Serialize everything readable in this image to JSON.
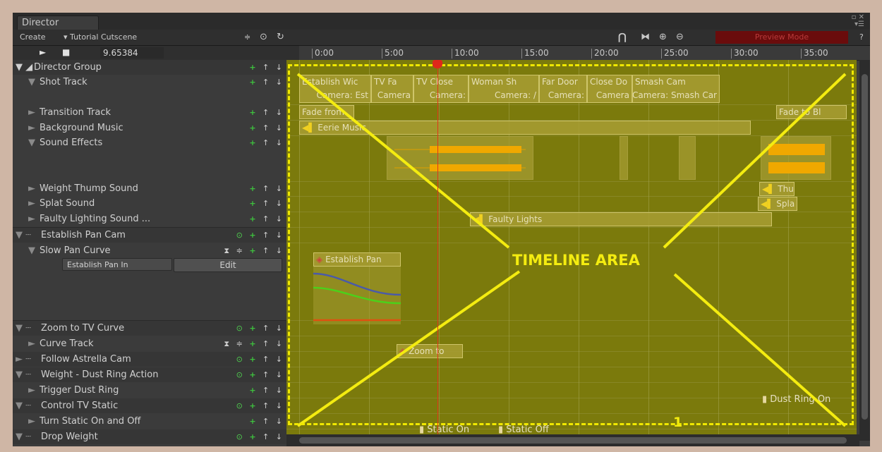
{
  "window": {
    "title": "Director",
    "icons": [
      "▫ ✕",
      "▾☰"
    ]
  },
  "toolbar": {
    "create": "Create",
    "cutscene": "▾ Tutorial Cutscene",
    "stepper": "≑",
    "settings_icon": "⊙",
    "refresh_icon": "↻",
    "magnet_icon": "⋂",
    "fit_icon": "⧓",
    "zoom_in_icon": "⊕",
    "zoom_out_icon": "⊖",
    "preview_mode": "Preview Mode",
    "help": "?"
  },
  "playback": {
    "play_icon": "►",
    "stop_icon": "■",
    "time": "9.65384"
  },
  "ruler": {
    "ticks": [
      "0:00",
      "5:00",
      "10:00",
      "15:00",
      "20:00",
      "25:00",
      "30:00",
      "35:00"
    ]
  },
  "tracks": {
    "director_group": "Director Group",
    "shot_track": "Shot Track",
    "transition_track": "Transition Track",
    "background_music": "Background Music",
    "sound_effects": "Sound Effects",
    "weight_thump": "Weight Thump Sound",
    "splat_sound": "Splat Sound",
    "faulty_lighting": "Faulty Lighting Sound ...",
    "establish_pan_cam": "Establish Pan Cam",
    "slow_pan_curve": "Slow Pan Curve",
    "establish_pan_in": "Establish Pan In",
    "edit": "Edit",
    "zoom_tv_curve": "Zoom to TV Curve",
    "curve_track": "Curve Track",
    "follow_astrella": "Follow Astrella Cam",
    "weight_dust": "Weight - Dust Ring Action",
    "trigger_dust": "Trigger Dust Ring",
    "control_tv_static": "Control TV Static",
    "turn_static": "Turn Static On and Off",
    "drop_weight": "Drop Weight"
  },
  "clips": {
    "shots": [
      {
        "a": "Establish Wic",
        "b": "Camera: Est"
      },
      {
        "a": "TV Fa",
        "b": "Camera"
      },
      {
        "a": "TV Close",
        "b": "Camera:"
      },
      {
        "a": "Woman Sh",
        "b": "Camera: /"
      },
      {
        "a": "Far Door",
        "b": "Camera:"
      },
      {
        "a": "Close Do",
        "b": "Camera"
      },
      {
        "a": "Smash Cam",
        "b": "Camera: Smash Car"
      }
    ],
    "fade_from": "Fade from",
    "fade_to": "Fade to Bl",
    "eerie_music": "Eerie Music",
    "thump": "Thu",
    "splat": "Spla",
    "faulty_lights": "Faulty Lights",
    "establish_pan": "Establish Pan",
    "zoom_to": "Zoom to",
    "dust_ring_on": "Dust Ring On",
    "static_on": "Static On",
    "static_off": "Static Off"
  },
  "overlay": {
    "label": "TIMELINE AREA",
    "number": "1"
  },
  "colors": {
    "highlight": "#f0e800",
    "playhead": "#e0381a",
    "clip": "#a89e34",
    "preview": "#6a0c0c"
  }
}
